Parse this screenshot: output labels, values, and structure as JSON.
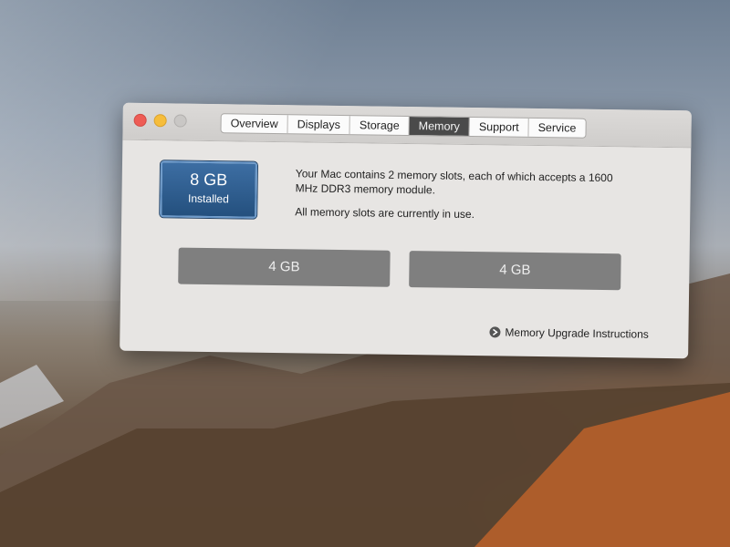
{
  "window": {
    "tabs": [
      {
        "label": "Overview"
      },
      {
        "label": "Displays"
      },
      {
        "label": "Storage"
      },
      {
        "label": "Memory"
      },
      {
        "label": "Support"
      },
      {
        "label": "Service"
      }
    ],
    "active_tab": "Memory"
  },
  "memory": {
    "installed_size": "8 GB",
    "installed_label": "Installed",
    "description_line1": "Your Mac contains 2 memory slots, each of which accepts a 1600 MHz DDR3 memory module.",
    "description_line2": "All memory slots are currently in use.",
    "slots": [
      {
        "label": "4 GB"
      },
      {
        "label": "4 GB"
      }
    ],
    "upgrade_link": "Memory Upgrade Instructions"
  },
  "colors": {
    "badge_blue": "#24507e",
    "slot_gray": "#7f7f7f",
    "close": "#ee5c55",
    "minimize": "#f6bd3b"
  }
}
